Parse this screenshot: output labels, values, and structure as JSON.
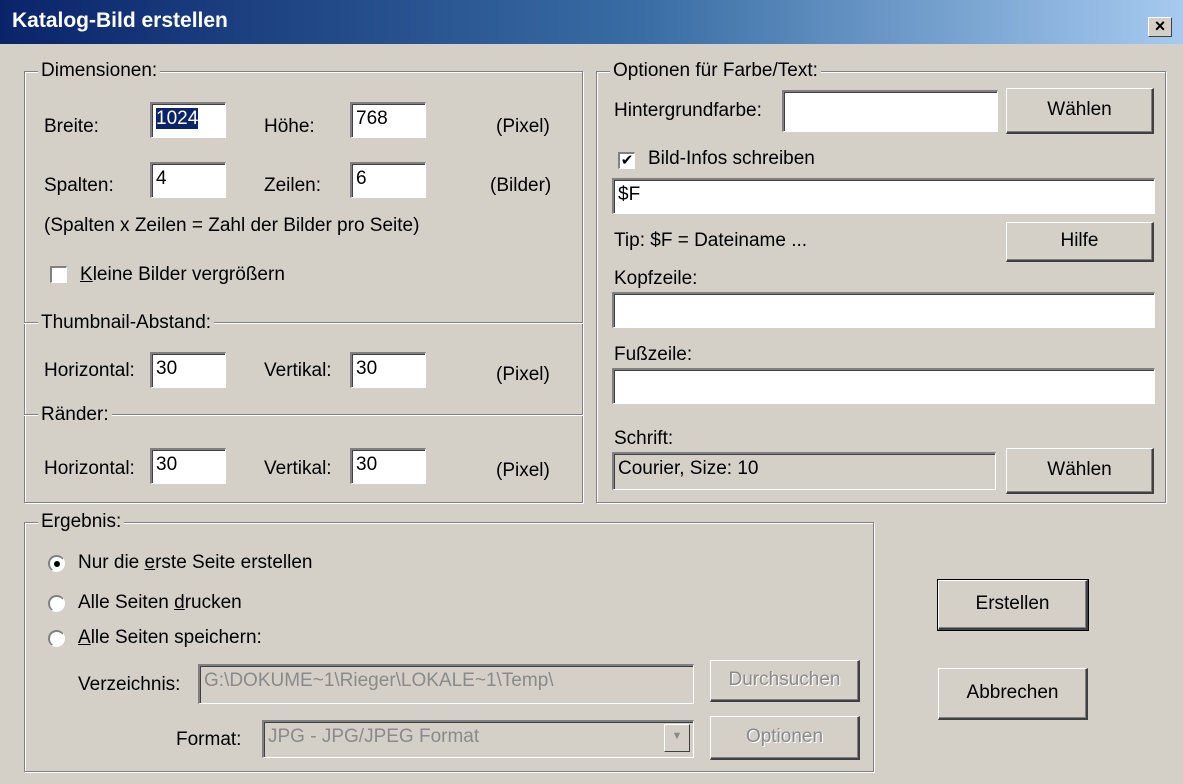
{
  "window": {
    "title": "Katalog-Bild erstellen",
    "close_glyph": "×"
  },
  "dimensions": {
    "legend": "Dimensionen:",
    "width_label": "Breite:",
    "width_value": "1024",
    "height_label": "Höhe:",
    "height_value": "768",
    "pixel_unit": "(Pixel)",
    "cols_label": "Spalten:",
    "cols_value": "4",
    "rows_label": "Zeilen:",
    "rows_value": "6",
    "images_unit": "(Bilder)",
    "hint": "(Spalten x Zeilen = Zahl der Bilder pro Seite)",
    "enlarge_label_underlined": "K",
    "enlarge_label_rest": "leine Bilder vergrößern",
    "enlarge_checked": false
  },
  "thumbnail_spacing": {
    "legend": "Thumbnail-Abstand:",
    "horizontal_label": "Horizontal:",
    "horizontal_value": "30",
    "vertical_label": "Vertikal:",
    "vertical_value": "30",
    "unit": "(Pixel)"
  },
  "margins": {
    "legend": "Ränder:",
    "horizontal_label": "Horizontal:",
    "horizontal_value": "30",
    "vertical_label": "Vertikal:",
    "vertical_value": "30",
    "unit": "(Pixel)"
  },
  "color_text": {
    "legend": "Optionen für Farbe/Text:",
    "bg_label": "Hintergrundfarbe:",
    "bg_value": "",
    "choose_label": "Wählen",
    "write_info_label": "Bild-Infos schreiben",
    "write_info_checked": true,
    "check_glyph": "✔",
    "info_value": "$F",
    "tip": "Tip: $F = Dateiname ...",
    "help_label": "Hilfe",
    "header_label": "Kopfzeile:",
    "header_value": "",
    "footer_label": "Fußzeile:",
    "footer_value": "",
    "font_label": "Schrift:",
    "font_value": "Courier, Size: 10",
    "font_choose_label": "Wählen"
  },
  "result": {
    "legend": "Ergebnis:",
    "options": [
      {
        "pre": "Nur die ",
        "ul": "e",
        "post": "rste Seite erstellen",
        "selected": true
      },
      {
        "pre": "Alle Seiten ",
        "ul": "d",
        "post": "rucken",
        "selected": false
      },
      {
        "pre": "",
        "ul": "A",
        "post": "lle Seiten speichern:",
        "selected": false
      }
    ],
    "dir_label": "Verzeichnis:",
    "dir_value": "G:\\DOKUME~1\\Rieger\\LOKALE~1\\Temp\\",
    "browse_label": "Durchsuchen",
    "format_label": "Format:",
    "format_value": "JPG - JPG/JPEG Format",
    "format_arrow": "▼",
    "options_label": "Optionen"
  },
  "actions": {
    "create_label": "Erstellen",
    "cancel_label": "Abbrechen"
  }
}
